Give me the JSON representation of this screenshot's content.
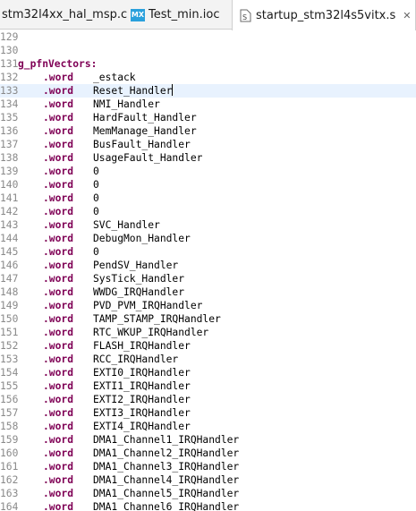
{
  "tabs": [
    {
      "label": "stm32l4xx_hal_msp.c",
      "icon": "c-file-icon",
      "active": false
    },
    {
      "label": "Test_min.ioc",
      "icon": "mx-icon",
      "icon_text": "MX",
      "active": false
    },
    {
      "label": "startup_stm32l4s5vitx.s",
      "icon": "asm-file-icon",
      "active": true,
      "close": "✕"
    }
  ],
  "editor": {
    "lines": [
      {
        "num": "129",
        "label": "",
        "keyword": "",
        "arg": ""
      },
      {
        "num": "130",
        "label": "",
        "keyword": "",
        "arg": ""
      },
      {
        "num": "131",
        "label": "g_pfnVectors:",
        "keyword": "",
        "arg": ""
      },
      {
        "num": "132",
        "label": "",
        "keyword": ".word",
        "arg": "_estack"
      },
      {
        "num": "133",
        "label": "",
        "keyword": ".word",
        "arg": "Reset_Handler",
        "current": true
      },
      {
        "num": "134",
        "label": "",
        "keyword": ".word",
        "arg": "NMI_Handler"
      },
      {
        "num": "135",
        "label": "",
        "keyword": ".word",
        "arg": "HardFault_Handler"
      },
      {
        "num": "136",
        "label": "",
        "keyword": ".word",
        "arg": "MemManage_Handler"
      },
      {
        "num": "137",
        "label": "",
        "keyword": ".word",
        "arg": "BusFault_Handler"
      },
      {
        "num": "138",
        "label": "",
        "keyword": ".word",
        "arg": "UsageFault_Handler"
      },
      {
        "num": "139",
        "label": "",
        "keyword": ".word",
        "arg": "0"
      },
      {
        "num": "140",
        "label": "",
        "keyword": ".word",
        "arg": "0"
      },
      {
        "num": "141",
        "label": "",
        "keyword": ".word",
        "arg": "0"
      },
      {
        "num": "142",
        "label": "",
        "keyword": ".word",
        "arg": "0"
      },
      {
        "num": "143",
        "label": "",
        "keyword": ".word",
        "arg": "SVC_Handler"
      },
      {
        "num": "144",
        "label": "",
        "keyword": ".word",
        "arg": "DebugMon_Handler"
      },
      {
        "num": "145",
        "label": "",
        "keyword": ".word",
        "arg": "0"
      },
      {
        "num": "146",
        "label": "",
        "keyword": ".word",
        "arg": "PendSV_Handler"
      },
      {
        "num": "147",
        "label": "",
        "keyword": ".word",
        "arg": "SysTick_Handler"
      },
      {
        "num": "148",
        "label": "",
        "keyword": ".word",
        "arg": "WWDG_IRQHandler"
      },
      {
        "num": "149",
        "label": "",
        "keyword": ".word",
        "arg": "PVD_PVM_IRQHandler"
      },
      {
        "num": "150",
        "label": "",
        "keyword": ".word",
        "arg": "TAMP_STAMP_IRQHandler"
      },
      {
        "num": "151",
        "label": "",
        "keyword": ".word",
        "arg": "RTC_WKUP_IRQHandler"
      },
      {
        "num": "152",
        "label": "",
        "keyword": ".word",
        "arg": "FLASH_IRQHandler"
      },
      {
        "num": "153",
        "label": "",
        "keyword": ".word",
        "arg": "RCC_IRQHandler"
      },
      {
        "num": "154",
        "label": "",
        "keyword": ".word",
        "arg": "EXTI0_IRQHandler"
      },
      {
        "num": "155",
        "label": "",
        "keyword": ".word",
        "arg": "EXTI1_IRQHandler"
      },
      {
        "num": "156",
        "label": "",
        "keyword": ".word",
        "arg": "EXTI2_IRQHandler"
      },
      {
        "num": "157",
        "label": "",
        "keyword": ".word",
        "arg": "EXTI3_IRQHandler"
      },
      {
        "num": "158",
        "label": "",
        "keyword": ".word",
        "arg": "EXTI4_IRQHandler"
      },
      {
        "num": "159",
        "label": "",
        "keyword": ".word",
        "arg": "DMA1_Channel1_IRQHandler"
      },
      {
        "num": "160",
        "label": "",
        "keyword": ".word",
        "arg": "DMA1_Channel2_IRQHandler"
      },
      {
        "num": "161",
        "label": "",
        "keyword": ".word",
        "arg": "DMA1_Channel3_IRQHandler"
      },
      {
        "num": "162",
        "label": "",
        "keyword": ".word",
        "arg": "DMA1_Channel4_IRQHandler"
      },
      {
        "num": "163",
        "label": "",
        "keyword": ".word",
        "arg": "DMA1_Channel5_IRQHandler"
      },
      {
        "num": "164",
        "label": "",
        "keyword": ".word",
        "arg": "DMA1_Channel6_IRQHandler"
      }
    ]
  },
  "colors": {
    "keyword": "#7f0055",
    "line_number": "#8a8a8a",
    "current_line": "#e8f2fe",
    "mx_icon": "#2aa0dc"
  }
}
